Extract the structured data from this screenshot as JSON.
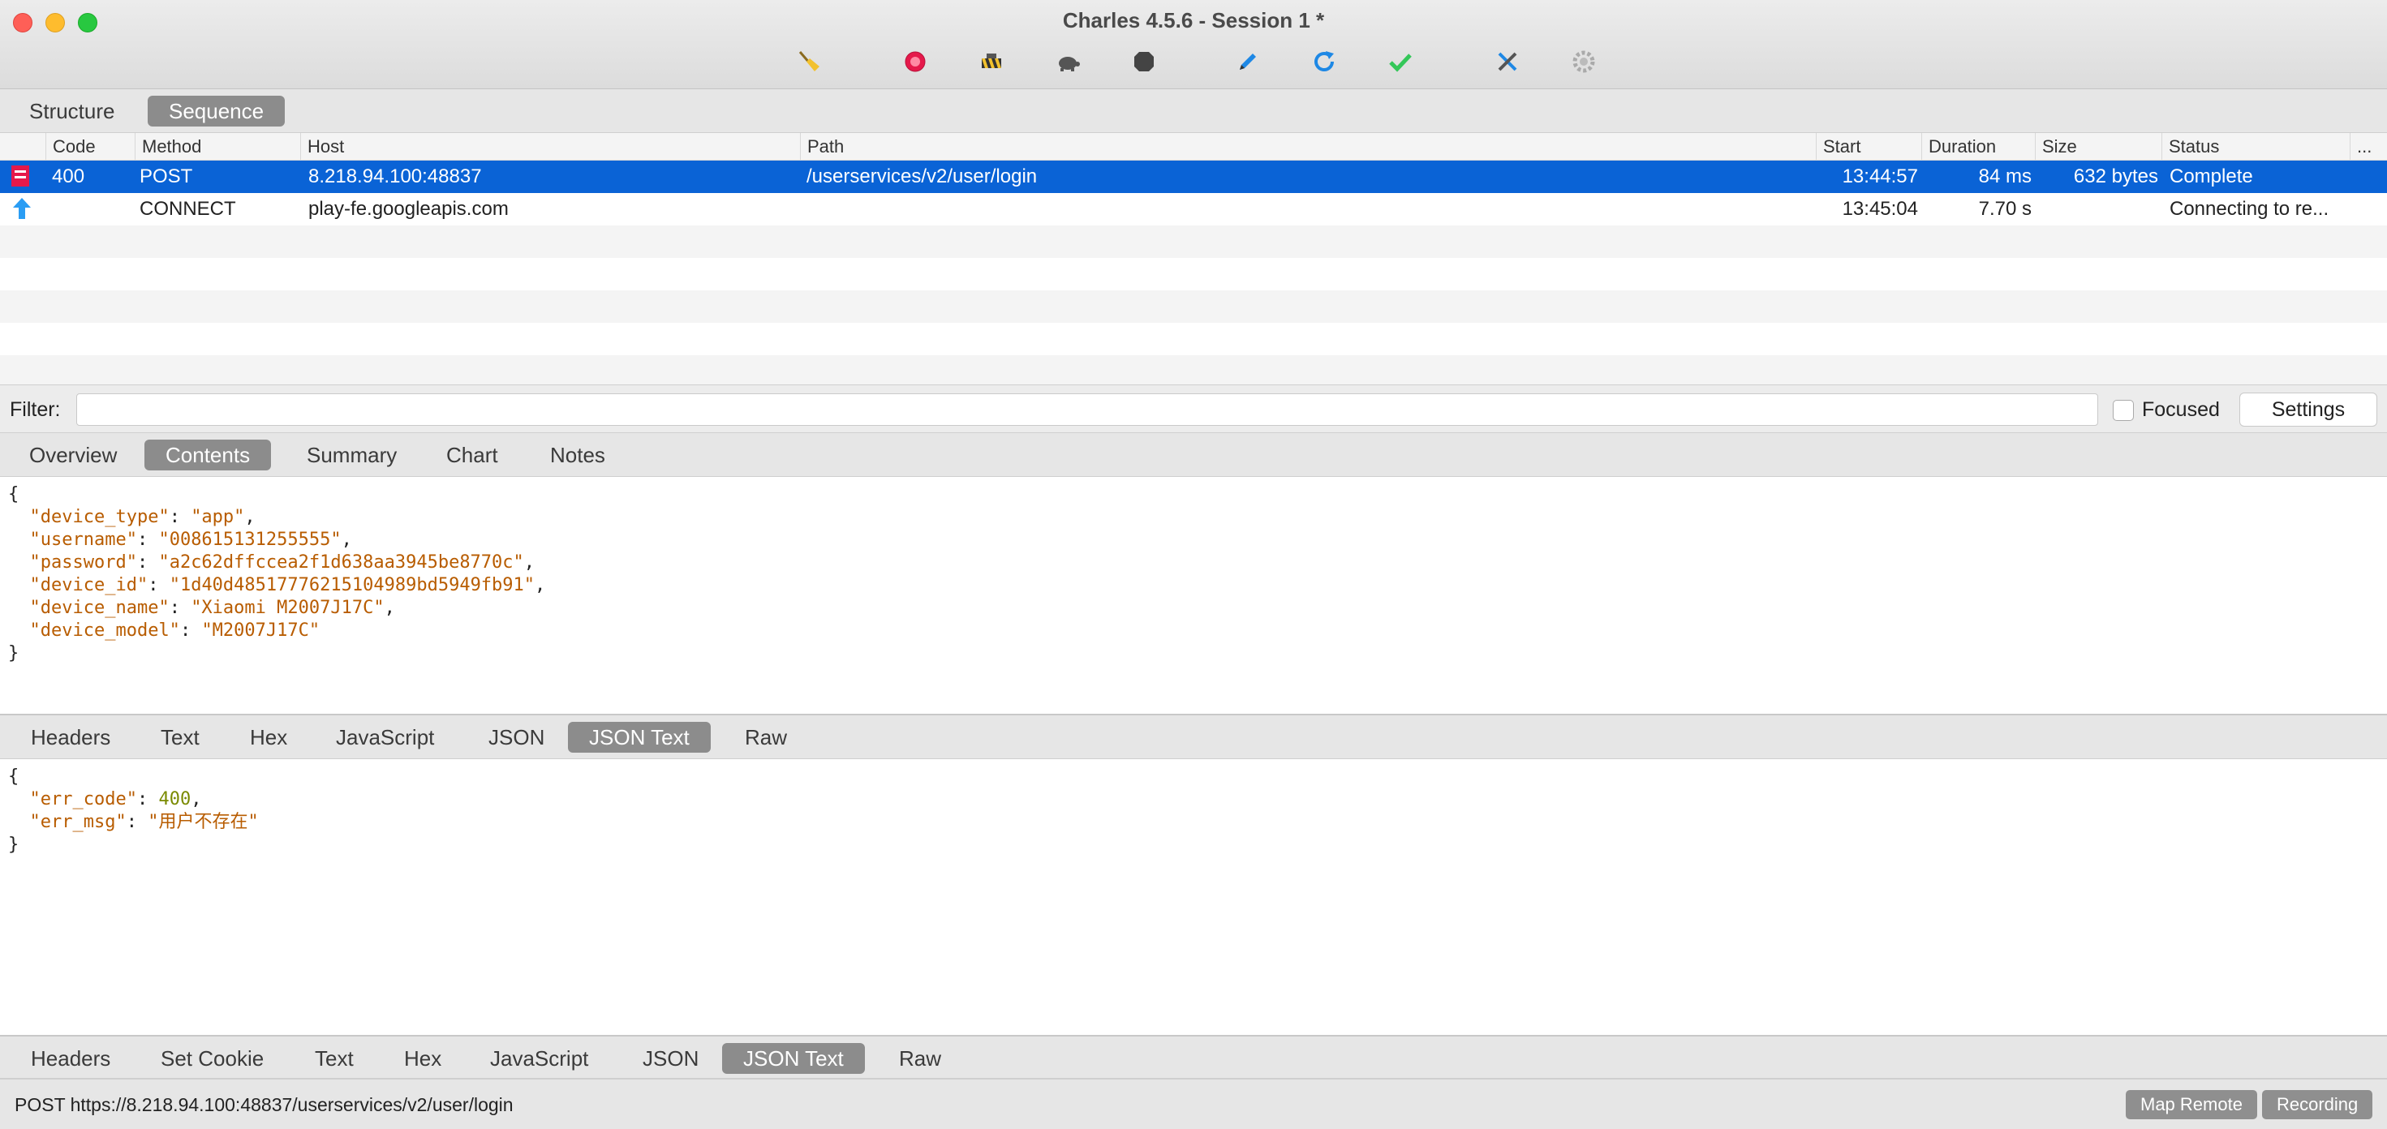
{
  "window": {
    "title": "Charles 4.5.6 - Session 1 *"
  },
  "toolbar": {
    "icons": [
      "broom-icon",
      "record-icon",
      "throttle-icon",
      "turtle-icon",
      "stop-icon",
      "pen-icon",
      "refresh-icon",
      "check-icon",
      "tools-icon",
      "gear-icon"
    ],
    "colors": {
      "record": "#e5194b",
      "refresh": "#1e88e5",
      "check": "#34c759",
      "pen": "#1e88e5"
    }
  },
  "view_tabs": [
    {
      "label": "Structure",
      "active": false
    },
    {
      "label": "Sequence",
      "active": true
    }
  ],
  "table": {
    "columns": [
      "Code",
      "Method",
      "Host",
      "Path",
      "Start",
      "Duration",
      "Size",
      "Status",
      "..."
    ],
    "rows": [
      {
        "code": "400",
        "method": "POST",
        "host": "8.218.94.100:48837",
        "path": "/userservices/v2/user/login",
        "start": "13:44:57",
        "duration": "84 ms",
        "size": "632 bytes",
        "status": "Complete",
        "selected": true
      },
      {
        "code": "",
        "method": "CONNECT",
        "host": "play-fe.googleapis.com",
        "path": "",
        "start": "13:45:04",
        "duration": "7.70 s",
        "size": "",
        "status": "Connecting to re...",
        "selected": false
      }
    ]
  },
  "filter": {
    "label": "Filter:",
    "value": "",
    "focused_label": "Focused",
    "settings_label": "Settings"
  },
  "detail_tabs": [
    {
      "label": "Overview",
      "active": false
    },
    {
      "label": "Contents",
      "active": true
    },
    {
      "label": "Summary",
      "active": false
    },
    {
      "label": "Chart",
      "active": false
    },
    {
      "label": "Notes",
      "active": false
    }
  ],
  "request_body": {
    "open": "{",
    "close": "}",
    "fields": [
      {
        "key": "\"device_type\"",
        "value": "\"app\""
      },
      {
        "key": "\"username\"",
        "value": "\"008615131255555\""
      },
      {
        "key": "\"password\"",
        "value": "\"a2c62dffccea2f1d638aa3945be8770c\""
      },
      {
        "key": "\"device_id\"",
        "value": "\"1d40d48517776215104989bd5949fb91\""
      },
      {
        "key": "\"device_name\"",
        "value": "\"Xiaomi M2007J17C\""
      },
      {
        "key": "\"device_model\"",
        "value": "\"M2007J17C\""
      }
    ]
  },
  "request_tabs": [
    {
      "label": "Headers",
      "active": false
    },
    {
      "label": "Text",
      "active": false
    },
    {
      "label": "Hex",
      "active": false
    },
    {
      "label": "JavaScript",
      "active": false
    },
    {
      "label": "JSON",
      "active": false
    },
    {
      "label": "JSON Text",
      "active": true
    },
    {
      "label": "Raw",
      "active": false
    }
  ],
  "response_body": {
    "open": "{",
    "close": "}",
    "err_code_key": "\"err_code\"",
    "err_code_value": "400",
    "err_msg_key": "\"err_msg\"",
    "err_msg_value": "\"用户不存在\""
  },
  "response_tabs": [
    {
      "label": "Headers",
      "active": false
    },
    {
      "label": "Set Cookie",
      "active": false
    },
    {
      "label": "Text",
      "active": false
    },
    {
      "label": "Hex",
      "active": false
    },
    {
      "label": "JavaScript",
      "active": false
    },
    {
      "label": "JSON",
      "active": false
    },
    {
      "label": "JSON Text",
      "active": true
    },
    {
      "label": "Raw",
      "active": false
    }
  ],
  "statusbar": {
    "url": "POST https://8.218.94.100:48837/userservices/v2/user/login",
    "map_remote": "Map Remote",
    "recording": "Recording"
  }
}
